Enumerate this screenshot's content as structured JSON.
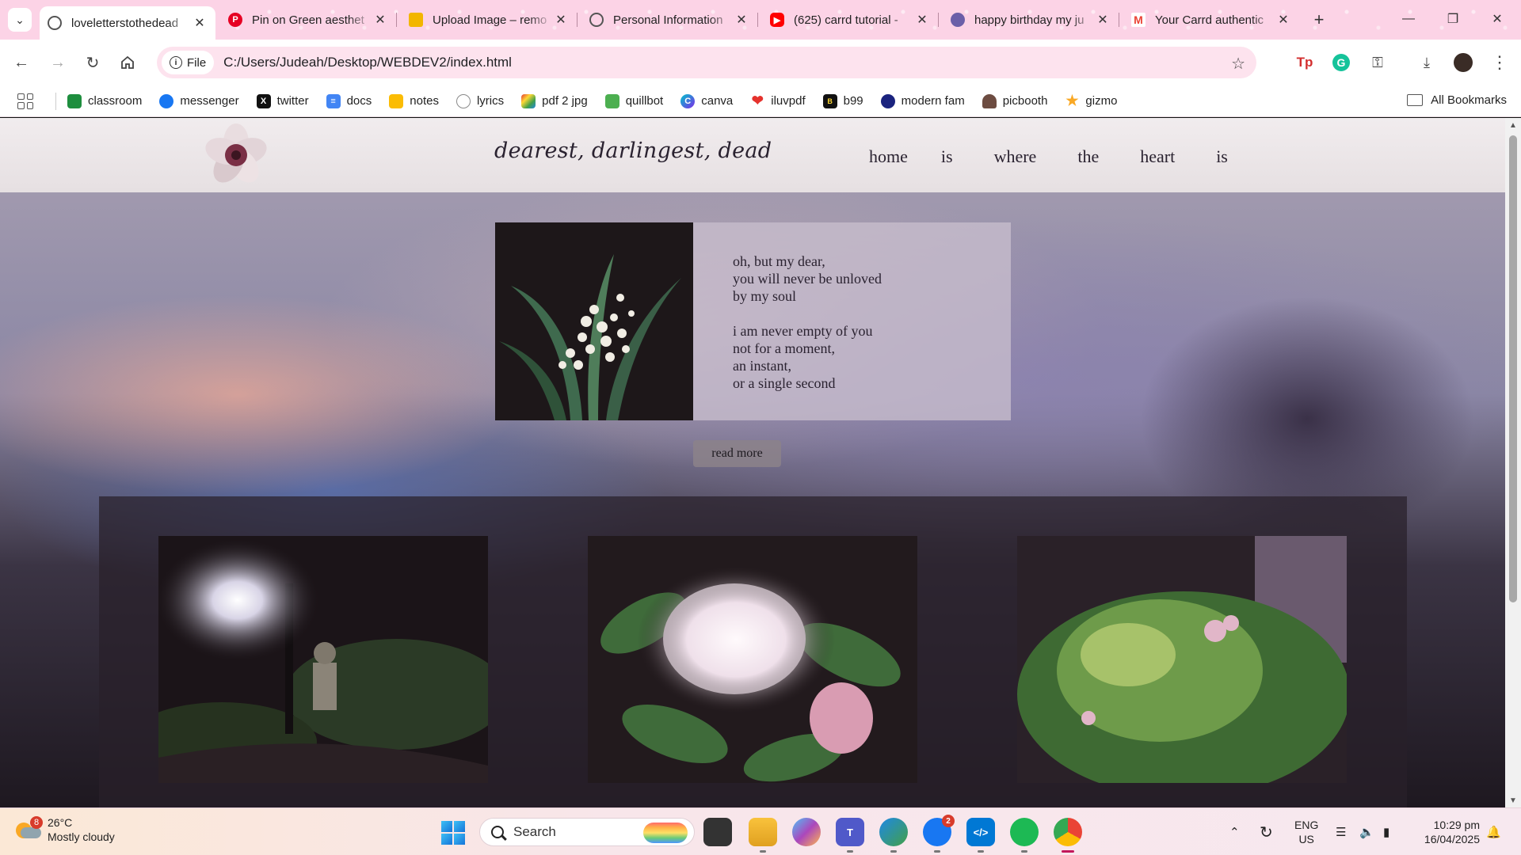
{
  "browser": {
    "tabs": [
      {
        "title": "loveletterstothedead",
        "icon": "globe-icon",
        "color": "#555555",
        "active": true
      },
      {
        "title": "Pin on Green aesthet",
        "icon": "pinterest-icon",
        "color": "#e60023",
        "active": false
      },
      {
        "title": "Upload Image – remo",
        "icon": "upload-icon",
        "color": "#f2b600",
        "active": false
      },
      {
        "title": "Personal Information",
        "icon": "globe-icon",
        "color": "#555555",
        "active": false
      },
      {
        "title": "(625) carrd tutorial -",
        "icon": "youtube-icon",
        "color": "#ff0000",
        "active": false
      },
      {
        "title": "happy birthday my ju",
        "icon": "carrd-icon",
        "color": "#6b5fa8",
        "active": false
      },
      {
        "title": "Your Carrd authentic",
        "icon": "gmail-icon",
        "color": "#ea4335",
        "active": false
      }
    ],
    "omnibox": {
      "chip_label": "File",
      "url": "C:/Users/Judeah/Desktop/WEBDEV2/index.html"
    },
    "bookmarks": [
      {
        "label": "classroom",
        "icon": "classroom-icon",
        "color": "#1e8e3e"
      },
      {
        "label": "messenger",
        "icon": "messenger-icon",
        "color": "#1877f2"
      },
      {
        "label": "twitter",
        "icon": "x-icon",
        "color": "#111111"
      },
      {
        "label": "docs",
        "icon": "docs-icon",
        "color": "#4285f4"
      },
      {
        "label": "notes",
        "icon": "notes-icon",
        "color": "#fbbc04"
      },
      {
        "label": "lyrics",
        "icon": "lyrics-icon",
        "color": "#8a8a8a"
      },
      {
        "label": "pdf 2 jpg",
        "icon": "pdf2jpg-icon",
        "color": "#e53935"
      },
      {
        "label": "quillbot",
        "icon": "quillbot-icon",
        "color": "#4caf50"
      },
      {
        "label": "canva",
        "icon": "canva-icon",
        "color": "#00c4cc"
      },
      {
        "label": "iluvpdf",
        "icon": "heart-icon",
        "color": "#e5322d"
      },
      {
        "label": "b99",
        "icon": "b99-icon",
        "color": "#111111"
      },
      {
        "label": "modern fam",
        "icon": "modern-fam-icon",
        "color": "#1a237e"
      },
      {
        "label": "picbooth",
        "icon": "picbooth-icon",
        "color": "#6d4c41"
      },
      {
        "label": "gizmo",
        "icon": "star-icon",
        "color": "#f9a825"
      }
    ],
    "all_bookmarks_label": "All Bookmarks"
  },
  "site": {
    "title": "dearest, darlingest, dead",
    "nav": [
      "home",
      "is",
      "where",
      "the",
      "heart",
      "is"
    ],
    "poem": {
      "stanza1": [
        "oh, but my dear,",
        "you will never be unloved",
        "by my soul"
      ],
      "stanza2": [
        "i am never empty of you",
        "not for a moment,",
        "an instant,",
        "or a single second"
      ]
    },
    "read_more_label": "read more"
  },
  "taskbar": {
    "weather": {
      "badge": "8",
      "temp": "26°C",
      "condition": "Mostly cloudy"
    },
    "search_placeholder": "Search",
    "messenger_badge": "2",
    "lang": {
      "line1": "ENG",
      "line2": "US"
    },
    "clock": {
      "time": "10:29 pm",
      "date": "16/04/2025"
    }
  }
}
